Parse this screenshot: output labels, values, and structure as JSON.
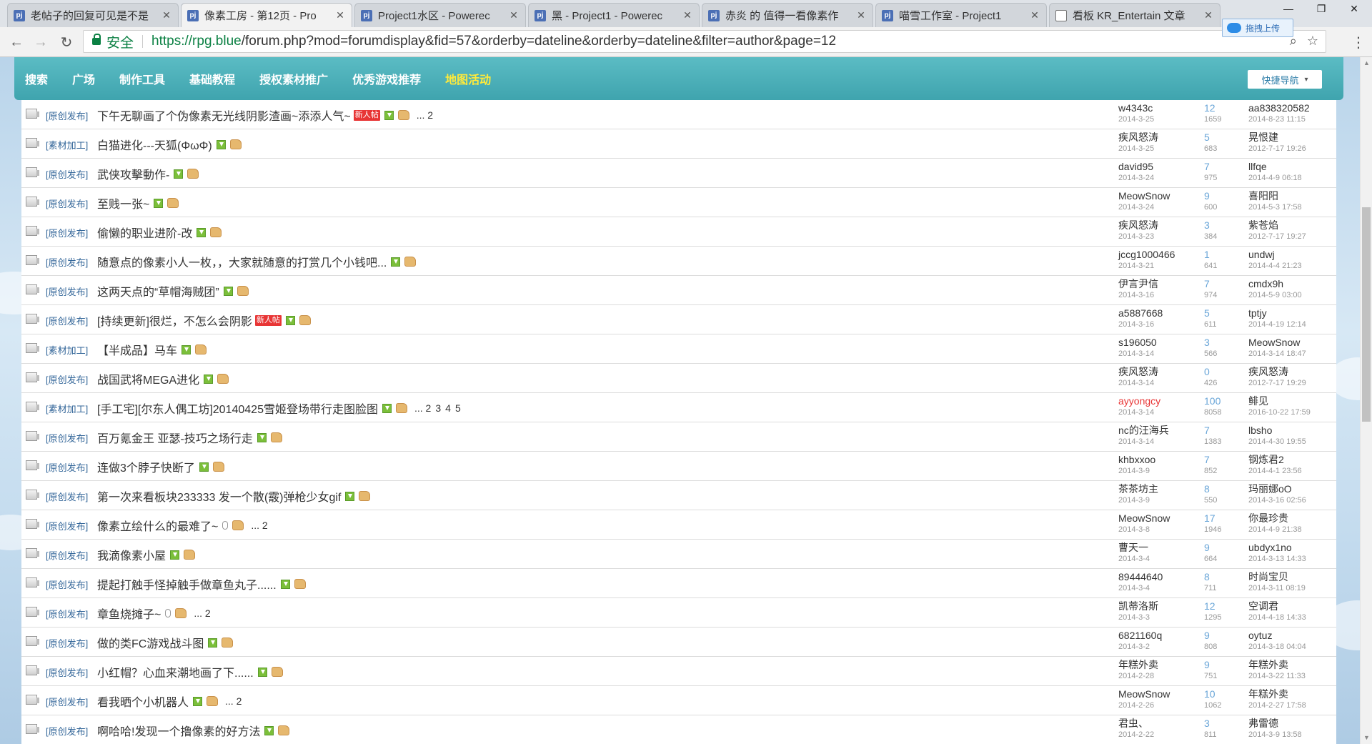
{
  "browser": {
    "tabs": [
      {
        "title": "老帖子的回复可见是不是",
        "favicon": "pj",
        "active": false
      },
      {
        "title": "像素工房 - 第12页 - Pro",
        "favicon": "pj",
        "active": true
      },
      {
        "title": "Project1水区 - Powerec",
        "favicon": "pj",
        "active": false
      },
      {
        "title": "黑 - Project1 - Powerec",
        "favicon": "pj",
        "active": false
      },
      {
        "title": "赤炎 的 值得一看像素作",
        "favicon": "pj",
        "active": false
      },
      {
        "title": "喵雪工作室 - Project1",
        "favicon": "pj",
        "active": false
      },
      {
        "title": "看板 KR_Entertain 文章",
        "favicon": "doc",
        "active": false
      }
    ],
    "tab_close": "✕",
    "security_label": "安全",
    "url_host": "https://rpg.blue",
    "url_path": "/forum.php?mod=forumdisplay&fid=57&orderby=dateline&orderby=dateline&filter=author&page=12",
    "upload_label": "拖拽上传"
  },
  "site_nav": {
    "items": [
      "搜索",
      "广场",
      "制作工具",
      "基础教程",
      "授权素材推广",
      "优秀游戏推荐",
      "地图活动"
    ],
    "highlight_index": 6,
    "quicknav_label": "快捷导航"
  },
  "threads": [
    {
      "cat": "[原创发布]",
      "title": "下午无聊画了个伪像素无光线阴影渣画~添添人气~",
      "new": true,
      "attach": "img",
      "pages": [
        "... 2"
      ],
      "author": "w4343c",
      "author_red": false,
      "date": "2014-3-25",
      "replies": "12",
      "views": "1659",
      "last": "aa838320582",
      "last_time": "2014-8-23 11:15"
    },
    {
      "cat": "[素材加工]",
      "title": "白猫进化---天狐(ΦωΦ)",
      "new": false,
      "attach": "img",
      "pages": [],
      "author": "疾风怒涛",
      "author_red": false,
      "date": "2014-3-25",
      "replies": "5",
      "views": "683",
      "last": "晃恨建",
      "last_time": "2012-7-17 19:26"
    },
    {
      "cat": "[原创发布]",
      "title": "武侠攻擊動作-",
      "new": false,
      "attach": "img",
      "pages": [],
      "author": "david95",
      "author_red": false,
      "date": "2014-3-24",
      "replies": "7",
      "views": "975",
      "last": "llfqe",
      "last_time": "2014-4-9 06:18"
    },
    {
      "cat": "[原创发布]",
      "title": "至贱一张~",
      "new": false,
      "attach": "img",
      "pages": [],
      "author": "MeowSnow",
      "author_red": false,
      "date": "2014-3-24",
      "replies": "9",
      "views": "600",
      "last": "喜阳阳",
      "last_time": "2014-5-3 17:58"
    },
    {
      "cat": "[原创发布]",
      "title": "偷懒的职业进阶-改",
      "new": false,
      "attach": "img",
      "pages": [],
      "author": "疾风怒涛",
      "author_red": false,
      "date": "2014-3-23",
      "replies": "3",
      "views": "384",
      "last": "紫苍焰",
      "last_time": "2012-7-17 19:27"
    },
    {
      "cat": "[原创发布]",
      "title": "随意点的像素小人一枚，，大家就随意的打赏几个小钱吧...",
      "new": false,
      "attach": "img",
      "pages": [],
      "author": "jccg1000466",
      "author_red": false,
      "date": "2014-3-21",
      "replies": "1",
      "views": "641",
      "last": "undwj",
      "last_time": "2014-4-4 21:23"
    },
    {
      "cat": "[原创发布]",
      "title": "这两天点的“草帽海贼团”",
      "new": false,
      "attach": "img",
      "pages": [],
      "author": "伊言尹信",
      "author_red": false,
      "date": "2014-3-16",
      "replies": "7",
      "views": "974",
      "last": "cmdx9h",
      "last_time": "2014-5-9 03:00"
    },
    {
      "cat": "[原创发布]",
      "title": "[持续更新]很烂，不怎么会阴影",
      "new": true,
      "attach": "img",
      "pages": [],
      "author": "a5887668",
      "author_red": false,
      "date": "2014-3-16",
      "replies": "5",
      "views": "611",
      "last": "tptjy",
      "last_time": "2014-4-19 12:14"
    },
    {
      "cat": "[素材加工]",
      "title": "【半成品】马车",
      "new": false,
      "attach": "img",
      "pages": [],
      "author": "s196050",
      "author_red": false,
      "date": "2014-3-14",
      "replies": "3",
      "views": "566",
      "last": "MeowSnow",
      "last_time": "2014-3-14 18:47"
    },
    {
      "cat": "[原创发布]",
      "title": "战国武将MEGA进化",
      "new": false,
      "attach": "img",
      "pages": [],
      "author": "疾风怒涛",
      "author_red": false,
      "date": "2014-3-14",
      "replies": "0",
      "views": "426",
      "last": "疾风怒涛",
      "last_time": "2012-7-17 19:29"
    },
    {
      "cat": "[素材加工]",
      "title": "[手工宅][尔东人偶工坊]20140425雪姬登场带行走图脸图",
      "new": false,
      "attach": "img",
      "pages": [
        "... 2",
        "3",
        "4",
        "5"
      ],
      "author": "ayyongcy",
      "author_red": true,
      "date": "2014-3-14",
      "replies": "100",
      "views": "8058",
      "last": "鲱见",
      "last_time": "2016-10-22 17:59"
    },
    {
      "cat": "[原创发布]",
      "title": "百万氪金王 亚瑟-技巧之场行走",
      "new": false,
      "attach": "img",
      "pages": [],
      "author": "nc的汪海兵",
      "author_red": false,
      "date": "2014-3-14",
      "replies": "7",
      "views": "1383",
      "last": "lbsho",
      "last_time": "2014-4-30 19:55"
    },
    {
      "cat": "[原创发布]",
      "title": "连做3个脖子快断了",
      "new": false,
      "attach": "img",
      "pages": [],
      "author": "khbxxoo",
      "author_red": false,
      "date": "2014-3-9",
      "replies": "7",
      "views": "852",
      "last": "钢炼君2",
      "last_time": "2014-4-1 23:56"
    },
    {
      "cat": "[原创发布]",
      "title": "第一次来看板块233333 发一个散(霰)弹枪少女gif",
      "new": false,
      "attach": "img",
      "pages": [],
      "author": "茶茶坊主",
      "author_red": false,
      "date": "2014-3-9",
      "replies": "8",
      "views": "550",
      "last": "玛丽娜oO",
      "last_time": "2014-3-16 02:56"
    },
    {
      "cat": "[原创发布]",
      "title": "像素立绘什么的最难了~",
      "new": false,
      "attach": "clip",
      "pages": [
        "... 2"
      ],
      "author": "MeowSnow",
      "author_red": false,
      "date": "2014-3-8",
      "replies": "17",
      "views": "1946",
      "last": "你最珍贵",
      "last_time": "2014-4-9 21:38"
    },
    {
      "cat": "[原创发布]",
      "title": "我滴像素小屋",
      "new": false,
      "attach": "img",
      "pages": [],
      "author": "曹天一",
      "author_red": false,
      "date": "2014-3-4",
      "replies": "9",
      "views": "664",
      "last": "ubdyx1no",
      "last_time": "2014-3-13 14:33"
    },
    {
      "cat": "[原创发布]",
      "title": "提起打触手怪掉触手做章鱼丸子......",
      "new": false,
      "attach": "img",
      "pages": [],
      "author": "89444640",
      "author_red": false,
      "date": "2014-3-4",
      "replies": "8",
      "views": "711",
      "last": "时尚宝贝",
      "last_time": "2014-3-11 08:19"
    },
    {
      "cat": "[原创发布]",
      "title": "章鱼烧摊子~",
      "new": false,
      "attach": "clip",
      "pages": [
        "... 2"
      ],
      "author": "凯蒂洛斯",
      "author_red": false,
      "date": "2014-3-3",
      "replies": "12",
      "views": "1295",
      "last": "空调君",
      "last_time": "2014-4-18 14:33"
    },
    {
      "cat": "[原创发布]",
      "title": "做的类FC游戏战斗图",
      "new": false,
      "attach": "img",
      "pages": [],
      "author": "6821160q",
      "author_red": false,
      "date": "2014-3-2",
      "replies": "9",
      "views": "808",
      "last": "oytuz",
      "last_time": "2014-3-18 04:04"
    },
    {
      "cat": "[原创发布]",
      "title": "小红帽？心血来潮地画了下......",
      "new": false,
      "attach": "img",
      "pages": [],
      "author": "年糕外卖",
      "author_red": false,
      "date": "2014-2-28",
      "replies": "9",
      "views": "751",
      "last": "年糕外卖",
      "last_time": "2014-3-22 11:33"
    },
    {
      "cat": "[原创发布]",
      "title": "看我晒个小机器人",
      "new": false,
      "attach": "img",
      "pages": [
        "... 2"
      ],
      "author": "MeowSnow",
      "author_red": false,
      "date": "2014-2-26",
      "replies": "10",
      "views": "1062",
      "last": "年糕外卖",
      "last_time": "2014-2-27 17:58"
    },
    {
      "cat": "[原创发布]",
      "title": "啊哈哈!发现一个撸像素的好方法",
      "new": false,
      "attach": "img",
      "pages": [],
      "author": "君虫、",
      "author_red": false,
      "date": "2014-2-22",
      "replies": "3",
      "views": "811",
      "last": "弗雷德",
      "last_time": "2014-3-9 13:58"
    }
  ],
  "labels": {
    "new_badge": "新人帖"
  },
  "colors": {
    "nav_bg": "#4aafb8",
    "nav_highlight": "#ffea3b",
    "category_link": "#336699",
    "reply_count": "#6aa6d8",
    "secure_green": "#0b8043"
  }
}
